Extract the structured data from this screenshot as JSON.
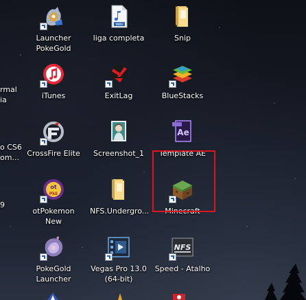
{
  "desktop": {
    "accent_highlight": "#e0141e",
    "partial_labels": [
      "rmal\nia",
      "o CS6\nom...",
      "9"
    ],
    "items": [
      {
        "label": "Launcher\nPokeGold",
        "icon": "pokegold-launcher-icon"
      },
      {
        "label": "liga completa",
        "icon": "wav-file-icon"
      },
      {
        "label": "Snip",
        "icon": "folder-icon"
      },
      {
        "label": "iTunes",
        "icon": "itunes-icon"
      },
      {
        "label": "ExitLag",
        "icon": "exitlag-icon"
      },
      {
        "label": "BlueStacks",
        "icon": "bluestacks-icon"
      },
      {
        "label": "CrossFire Elite",
        "icon": "crossfire-icon"
      },
      {
        "label": "Screenshot_1",
        "icon": "image-file-icon"
      },
      {
        "label": "Template AE",
        "icon": "after-effects-icon"
      },
      {
        "label": "otPokemon New",
        "icon": "otpokemon-icon"
      },
      {
        "label": "NFS.Undergro...",
        "icon": "folder-icon"
      },
      {
        "label": "Minecraft",
        "icon": "minecraft-icon"
      },
      {
        "label": "PokeGold\nLauncher",
        "icon": "pokegold-launcher-icon"
      },
      {
        "label": "Vegas Pro 13.0\n(64-bit)",
        "icon": "vegas-pro-icon"
      },
      {
        "label": "Speed - Atalho",
        "icon": "nfs-icon"
      }
    ]
  }
}
